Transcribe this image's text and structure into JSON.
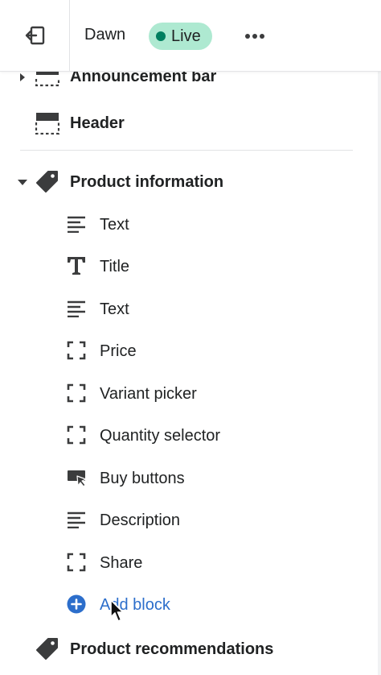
{
  "topbar": {
    "theme_name": "Dawn",
    "status": "Live"
  },
  "sections": {
    "announcement": "Announcement bar",
    "header": "Header",
    "product_information": "Product information",
    "product_recommendations": "Product recommendations"
  },
  "blocks": [
    {
      "label": "Text",
      "icon": "text-lines-icon"
    },
    {
      "label": "Title",
      "icon": "title-t-icon"
    },
    {
      "label": "Text",
      "icon": "text-lines-icon"
    },
    {
      "label": "Price",
      "icon": "dashed-box-icon"
    },
    {
      "label": "Variant picker",
      "icon": "dashed-box-icon"
    },
    {
      "label": "Quantity selector",
      "icon": "dashed-box-icon"
    },
    {
      "label": "Buy buttons",
      "icon": "buy-buttons-icon"
    },
    {
      "label": "Description",
      "icon": "text-lines-icon"
    },
    {
      "label": "Share",
      "icon": "dashed-box-icon"
    }
  ],
  "add_block": "Add block",
  "colors": {
    "live_badge": "#aee9d1",
    "live_dot": "#007f5f",
    "link": "#2c6ecb"
  }
}
